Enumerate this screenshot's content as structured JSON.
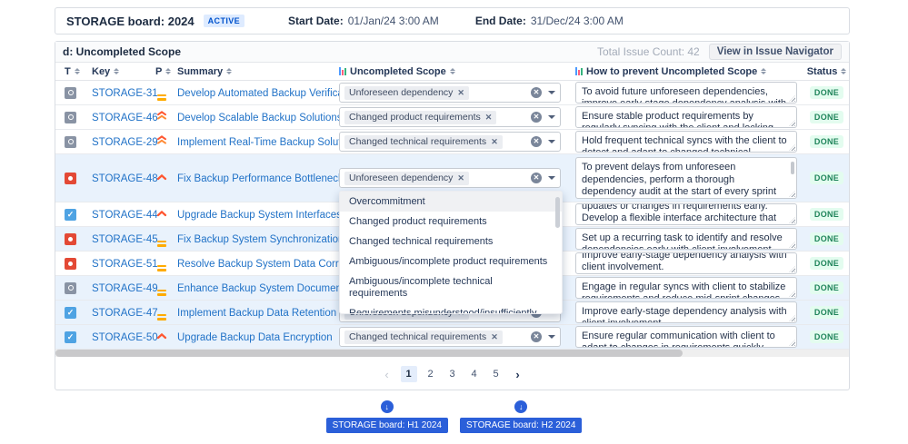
{
  "board": {
    "title": "STORAGE board: 2024",
    "status_badge": "ACTIVE",
    "start_label": "Start Date:",
    "start_value": "01/Jan/24 3:00 AM",
    "end_label": "End Date:",
    "end_value": "31/Dec/24 3:00 AM"
  },
  "panel": {
    "title": "d: Uncompleted Scope",
    "total_count_label": "Total Issue Count: 42",
    "view_button_label": "View in Issue Navigator"
  },
  "columns": [
    {
      "id": "t",
      "label": "T"
    },
    {
      "id": "key",
      "label": "Key"
    },
    {
      "id": "p",
      "label": "P"
    },
    {
      "id": "summary",
      "label": "Summary"
    },
    {
      "id": "scope",
      "label": "Uncompleted Scope",
      "chart_icon": true
    },
    {
      "id": "prevent",
      "label": "How to prevent Uncompleted Scope",
      "chart_icon": true
    },
    {
      "id": "status",
      "label": "Status"
    }
  ],
  "rows": [
    {
      "type": "gear",
      "key": "STORAGE-31",
      "priority": "medium",
      "summary": "Develop Automated Backup Verification",
      "scope": "Unforeseen dependency",
      "prevent": "To avoid future unforeseen dependencies, improve early-stage dependency analysis with client involvement.",
      "status": "DONE",
      "highlighted": false,
      "tall": false,
      "open": false,
      "scrolled": false,
      "scope_hidden": false
    },
    {
      "type": "gear",
      "key": "STORAGE-46",
      "priority": "highest",
      "summary": "Develop Scalable Backup Solutions",
      "scope": "Changed product requirements",
      "prevent": "Ensure stable product requirements by regularly syncing with the client and locking scope before each sprint.",
      "status": "DONE",
      "highlighted": false,
      "tall": false,
      "open": false,
      "scrolled": false,
      "scope_hidden": false
    },
    {
      "type": "gear",
      "key": "STORAGE-29",
      "priority": "highest",
      "summary": "Implement Real-Time Backup Solutions",
      "scope": "Changed technical requirements",
      "prevent": "Hold frequent technical syncs with the client to detect and adapt to changed technical requirements early.",
      "status": "DONE",
      "highlighted": false,
      "tall": false,
      "open": false,
      "scrolled": false,
      "scope_hidden": false
    },
    {
      "type": "bug",
      "key": "STORAGE-48",
      "priority": "high",
      "summary": "Fix Backup Performance Bottlenecks",
      "scope": "Unforeseen dependency",
      "prevent": "To prevent delays from unforeseen dependencies, perform a thorough dependency audit at the start of every sprint and include the client in this process. Use updates or changes in requirements early.",
      "status": "DONE",
      "highlighted": true,
      "tall": true,
      "open": true,
      "scrolled": false,
      "scope_hidden": false
    },
    {
      "type": "check",
      "key": "STORAGE-44",
      "priority": "high",
      "summary": "Upgrade Backup System Interfaces",
      "scope": "",
      "prevent": "updates or changes in requirements early. Develop a flexible interface architecture that allows for quick",
      "status": "DONE",
      "highlighted": false,
      "tall": false,
      "open": false,
      "scrolled": true,
      "scope_hidden": true
    },
    {
      "type": "bug",
      "key": "STORAGE-45",
      "priority": "medium",
      "summary": "Fix Backup System Synchronization Issues",
      "scope": "",
      "prevent": "Set up a recurring task to identify and resolve dependencies early with client involvement.",
      "status": "DONE",
      "highlighted": true,
      "tall": false,
      "open": false,
      "scrolled": false,
      "scope_hidden": true
    },
    {
      "type": "bug",
      "key": "STORAGE-51",
      "priority": "medium",
      "summary": "Resolve Backup System Data Corruption",
      "scope": "",
      "prevent": "Improve early-stage dependency analysis with client involvement.",
      "status": "DONE",
      "highlighted": false,
      "tall": false,
      "open": false,
      "scrolled": true,
      "scope_hidden": true
    },
    {
      "type": "gear",
      "key": "STORAGE-49",
      "priority": "medium",
      "summary": "Enhance Backup System Documentation",
      "scope": "",
      "prevent": "Engage in regular syncs with client to stabilize requirements and reduce mid-sprint changes.",
      "status": "DONE",
      "highlighted": true,
      "tall": false,
      "open": false,
      "scrolled": false,
      "scope_hidden": true
    },
    {
      "type": "check",
      "key": "STORAGE-47",
      "priority": "medium",
      "summary": "Implement Backup Data Retention Policies",
      "scope": "Unforeseen dependency",
      "prevent": "Improve early-stage dependency analysis with client involvement.",
      "status": "DONE",
      "highlighted": true,
      "tall": false,
      "open": false,
      "scrolled": false,
      "scope_hidden": false
    },
    {
      "type": "check",
      "key": "STORAGE-50",
      "priority": "high",
      "summary": "Upgrade Backup Data Encryption",
      "scope": "Changed technical requirements",
      "prevent": "Ensure regular communication with client to adapt to changes in requirements quickly.",
      "status": "DONE",
      "highlighted": true,
      "tall": false,
      "open": false,
      "scrolled": false,
      "scope_hidden": false
    }
  ],
  "dropdown": {
    "options": [
      "Overcommitment",
      "Changed product requirements",
      "Changed technical requirements",
      "Ambiguous/incomplete product requirements",
      "Ambiguous/incomplete technical requirements",
      "Requirements misunderstood/insufficiently analyzed by an engineer"
    ],
    "active_option": "Overcommitment"
  },
  "pagination": {
    "prev": "‹",
    "pages": [
      "1",
      "2",
      "3",
      "4",
      "5"
    ],
    "current": "1",
    "next": "›"
  },
  "footer": {
    "buttons": [
      {
        "label": "STORAGE board: H1 2024"
      },
      {
        "label": "STORAGE board: H2 2024"
      }
    ],
    "download_icon": "down-arrow"
  },
  "colors": {
    "accent_blue": "#2b5fd9",
    "link_blue": "#2172c7",
    "done_green": "#1f845a",
    "row_highlight": "#e9f2fc",
    "active_badge_bg": "#deebff",
    "active_badge_text": "#0052cc"
  }
}
